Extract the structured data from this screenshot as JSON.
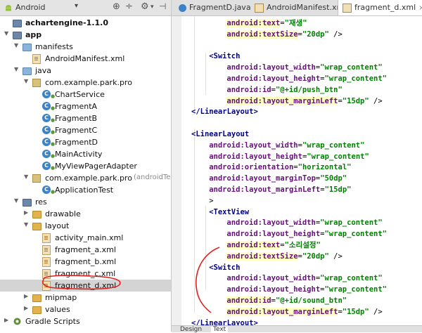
{
  "project_panel": {
    "view_label": "Android",
    "tree": [
      {
        "label": "achartengine-1.1.0",
        "depth": 0,
        "kind": "module",
        "bold": true,
        "arrow": ""
      },
      {
        "label": "app",
        "depth": 0,
        "kind": "module",
        "bold": true,
        "arrow": "down"
      },
      {
        "label": "manifests",
        "depth": 1,
        "kind": "folder-blue",
        "arrow": "down"
      },
      {
        "label": "AndroidManifest.xml",
        "depth": 2,
        "kind": "xml",
        "arrow": ""
      },
      {
        "label": "java",
        "depth": 1,
        "kind": "folder-blue",
        "arrow": "down"
      },
      {
        "label": "com.example.park.pro",
        "depth": 2,
        "kind": "package",
        "arrow": "down"
      },
      {
        "label": "ChartService",
        "depth": 3,
        "kind": "class",
        "arrow": ""
      },
      {
        "label": "FragmentA",
        "depth": 3,
        "kind": "class",
        "arrow": ""
      },
      {
        "label": "FragmentB",
        "depth": 3,
        "kind": "class",
        "arrow": ""
      },
      {
        "label": "FragmentC",
        "depth": 3,
        "kind": "class",
        "arrow": ""
      },
      {
        "label": "FragmentD",
        "depth": 3,
        "kind": "class",
        "arrow": ""
      },
      {
        "label": "MainActivity",
        "depth": 3,
        "kind": "class",
        "arrow": ""
      },
      {
        "label": "MyViewPagerAdapter",
        "depth": 3,
        "kind": "class",
        "arrow": ""
      },
      {
        "label": "com.example.park.pro",
        "suffix": "(androidTest)",
        "depth": 2,
        "kind": "package",
        "arrow": "down"
      },
      {
        "label": "ApplicationTest",
        "depth": 3,
        "kind": "class",
        "arrow": ""
      },
      {
        "label": "res",
        "depth": 1,
        "kind": "folder-dark",
        "arrow": "down"
      },
      {
        "label": "drawable",
        "depth": 2,
        "kind": "folder",
        "arrow": "right"
      },
      {
        "label": "layout",
        "depth": 2,
        "kind": "folder",
        "arrow": "down"
      },
      {
        "label": "activity_main.xml",
        "depth": 3,
        "kind": "xml",
        "arrow": ""
      },
      {
        "label": "fragment_a.xml",
        "depth": 3,
        "kind": "xml",
        "arrow": ""
      },
      {
        "label": "fragment_b.xml",
        "depth": 3,
        "kind": "xml",
        "arrow": ""
      },
      {
        "label": "fragment_c.xml",
        "depth": 3,
        "kind": "xml",
        "arrow": ""
      },
      {
        "label": "fragment_d.xml",
        "depth": 3,
        "kind": "xml",
        "arrow": "",
        "selected": true
      },
      {
        "label": "mipmap",
        "depth": 2,
        "kind": "folder",
        "arrow": "right"
      },
      {
        "label": "values",
        "depth": 2,
        "kind": "folder",
        "arrow": "right"
      },
      {
        "label": "Gradle Scripts",
        "depth": 0,
        "kind": "gradle",
        "arrow": "right"
      }
    ]
  },
  "editor_tabs": [
    {
      "label": "FragmentD.java",
      "kind": "class",
      "active": false
    },
    {
      "label": "AndroidManifest.xml",
      "kind": "xml",
      "active": false
    },
    {
      "label": "fragment_d.xml",
      "kind": "xml",
      "active": true
    }
  ],
  "code_lines": [
    {
      "indent": 4,
      "parts": [
        [
          "attr",
          "android:text"
        ],
        [
          "pun",
          "="
        ],
        [
          "val",
          "\"재생\""
        ]
      ]
    },
    {
      "indent": 4,
      "parts": [
        [
          "attr",
          "android:textSize"
        ],
        [
          "pun",
          "="
        ],
        [
          "val",
          "\"20dp\""
        ],
        [
          "pun",
          " />"
        ]
      ]
    },
    {
      "indent": 0,
      "parts": []
    },
    {
      "indent": 2,
      "parts": [
        [
          "tag",
          "<Switch"
        ]
      ]
    },
    {
      "indent": 4,
      "parts": [
        [
          "attr",
          "android:layout_width"
        ],
        [
          "pun",
          "="
        ],
        [
          "val",
          "\"wrap_content\""
        ]
      ]
    },
    {
      "indent": 4,
      "parts": [
        [
          "attr",
          "android:layout_height"
        ],
        [
          "pun",
          "="
        ],
        [
          "val",
          "\"wrap_content\""
        ]
      ]
    },
    {
      "indent": 4,
      "parts": [
        [
          "attr",
          "android:id"
        ],
        [
          "pun",
          "="
        ],
        [
          "val",
          "\"@+id/push_btn\""
        ]
      ]
    },
    {
      "indent": 4,
      "parts": [
        [
          "attr",
          "android:layout_marginLeft"
        ],
        [
          "pun",
          "="
        ],
        [
          "val",
          "\"15dp\""
        ],
        [
          "pun",
          " />"
        ]
      ]
    },
    {
      "indent": 0,
      "parts": [
        [
          "tag",
          "</LinearLayout>"
        ]
      ]
    },
    {
      "indent": 0,
      "parts": []
    },
    {
      "indent": 0,
      "parts": [
        [
          "tag",
          "<LinearLayout"
        ]
      ]
    },
    {
      "indent": 2,
      "parts": [
        [
          "attr",
          "android:layout_width"
        ],
        [
          "pun",
          "="
        ],
        [
          "val",
          "\"wrap_content\""
        ]
      ]
    },
    {
      "indent": 2,
      "parts": [
        [
          "attr",
          "android:layout_height"
        ],
        [
          "pun",
          "="
        ],
        [
          "val",
          "\"wrap_content\""
        ]
      ]
    },
    {
      "indent": 2,
      "parts": [
        [
          "attr",
          "android:orientation"
        ],
        [
          "pun",
          "="
        ],
        [
          "val",
          "\"horizontal\""
        ]
      ]
    },
    {
      "indent": 2,
      "parts": [
        [
          "attr",
          "android:layout_marginTop"
        ],
        [
          "pun",
          "="
        ],
        [
          "val",
          "\"50dp\""
        ]
      ]
    },
    {
      "indent": 2,
      "parts": [
        [
          "attr",
          "android:layout_marginLeft"
        ],
        [
          "pun",
          "="
        ],
        [
          "val",
          "\"15dp\""
        ]
      ]
    },
    {
      "indent": 2,
      "parts": [
        [
          "pun",
          ">"
        ]
      ]
    },
    {
      "indent": 2,
      "parts": [
        [
          "tag",
          "<TextView"
        ]
      ]
    },
    {
      "indent": 4,
      "parts": [
        [
          "attr",
          "android:layout_width"
        ],
        [
          "pun",
          "="
        ],
        [
          "val",
          "\"wrap_content\""
        ]
      ]
    },
    {
      "indent": 4,
      "parts": [
        [
          "attr",
          "android:layout_height"
        ],
        [
          "pun",
          "="
        ],
        [
          "val",
          "\"wrap_content\""
        ]
      ]
    },
    {
      "indent": 4,
      "parts": [
        [
          "attr",
          "android:text"
        ],
        [
          "pun",
          "="
        ],
        [
          "val",
          "\"소리설정\""
        ]
      ]
    },
    {
      "indent": 4,
      "parts": [
        [
          "attr",
          "android:textSize"
        ],
        [
          "pun",
          "="
        ],
        [
          "val",
          "\"20dp\""
        ],
        [
          "pun",
          " />"
        ]
      ]
    },
    {
      "indent": 2,
      "parts": [
        [
          "tag",
          "<Switch"
        ]
      ]
    },
    {
      "indent": 4,
      "parts": [
        [
          "attr",
          "android:layout_width"
        ],
        [
          "pun",
          "="
        ],
        [
          "val",
          "\"wrap_content\""
        ]
      ]
    },
    {
      "indent": 4,
      "parts": [
        [
          "attr",
          "android:layout_height"
        ],
        [
          "pun",
          "="
        ],
        [
          "val",
          "\"wrap_content\""
        ]
      ]
    },
    {
      "indent": 4,
      "parts": [
        [
          "attr",
          "android:id"
        ],
        [
          "pun",
          "="
        ],
        [
          "val",
          "\"@+id/sound_btn\""
        ]
      ]
    },
    {
      "indent": 4,
      "parts": [
        [
          "attr",
          "android:layout_marginLeft"
        ],
        [
          "pun",
          "="
        ],
        [
          "val",
          "\"15dp\""
        ],
        [
          "pun",
          " />"
        ]
      ]
    },
    {
      "indent": 0,
      "parts": [
        [
          "tag",
          "</LinearLayout>"
        ]
      ]
    }
  ],
  "bottom_tabs": [
    "Design",
    "Text"
  ],
  "colors": {
    "selection": "#d4d4d4",
    "annotation": "#e02020",
    "tag": "#000080",
    "attr": "#660e7a",
    "value": "#008000"
  }
}
